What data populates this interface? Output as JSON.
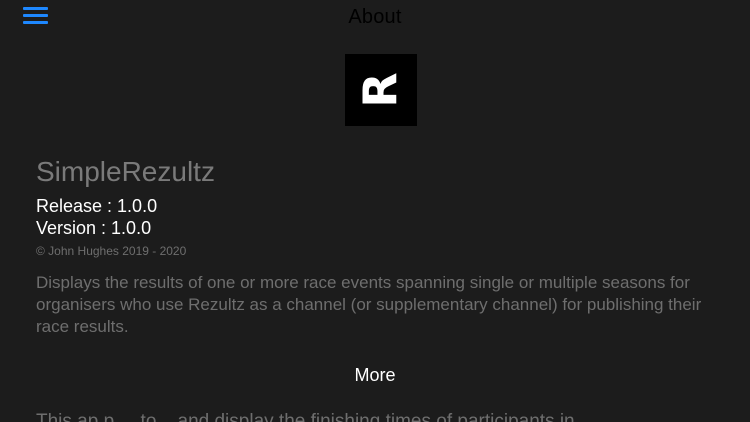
{
  "header": {
    "title": "About",
    "menu_icon": "hamburger-menu-icon",
    "accent_color": "#1e88ff"
  },
  "logo": {
    "letter": "R"
  },
  "app": {
    "name": "SimpleRezultz",
    "release": "Release : 1.0.0",
    "version": "Version :  1.0.0",
    "copyright": "© John Hughes 2019 - 2020",
    "description": "Displays the results of one or more race events spanning single or multiple seasons for organisers who use Rezultz as a channel (or supplementary channel) for publishing their race results."
  },
  "more": {
    "label": "More"
  },
  "footer": {
    "partial_text": "This ap p ... to... and display the finishing times of participants in..."
  }
}
